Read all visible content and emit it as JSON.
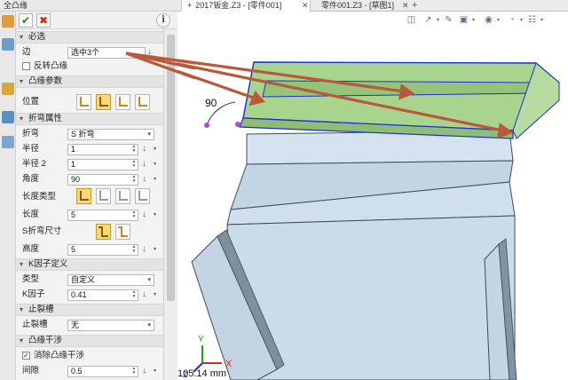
{
  "panel": {
    "title": "全凸缘",
    "sections": {
      "required": "必选",
      "flange_params": "凸缘参数",
      "bend_props": "折弯属性",
      "k_factor_def": "K因子定义",
      "relief": "止裂槽",
      "interference": "凸缘干涉"
    },
    "fields": {
      "edge": {
        "label": "边",
        "value": "选中3个"
      },
      "reverse_flange": {
        "label": "反转凸缘",
        "checked": false
      },
      "position": {
        "label": "位置"
      },
      "bend": {
        "label": "折弯",
        "value": "S 折弯"
      },
      "radius": {
        "label": "半径",
        "value": "1"
      },
      "radius2": {
        "label": "半径 2",
        "value": "1"
      },
      "angle": {
        "label": "角度",
        "value": "90"
      },
      "length_type": {
        "label": "长度类型"
      },
      "length": {
        "label": "长度",
        "value": "5"
      },
      "s_bend_size": {
        "label": "S折弯尺寸"
      },
      "height": {
        "label": "高度",
        "value": "5"
      },
      "k_type": {
        "label": "类型",
        "value": "自定义"
      },
      "k_factor": {
        "label": "K因子",
        "value": "0.41"
      },
      "relief_slot": {
        "label": "止裂槽",
        "value": "无"
      },
      "remove_interference": {
        "label": "消除凸缘干涉",
        "checked": true
      },
      "gap": {
        "label": "间隙",
        "value": "0.5"
      }
    }
  },
  "tabs": {
    "add_symbol": "+",
    "items": [
      {
        "label": "2017钣金.Z3 - [零件001]",
        "active": true
      },
      {
        "label": "零件001.Z3 - [草图1]",
        "active": false
      }
    ]
  },
  "viewport": {
    "dimension_text": "90",
    "axis_x": "X",
    "axis_y": "Y",
    "axis_z": "Z",
    "coordinate_text": "105.14 mm"
  },
  "colors": {
    "accent_green": "#1e8a1e",
    "cancel_red": "#d42a1a",
    "selection_blue": "#1b2fd6",
    "flange_green": "#a8d48e",
    "sheet_metal": "#c9dcea",
    "arrow_brown": "#b85a3a"
  }
}
